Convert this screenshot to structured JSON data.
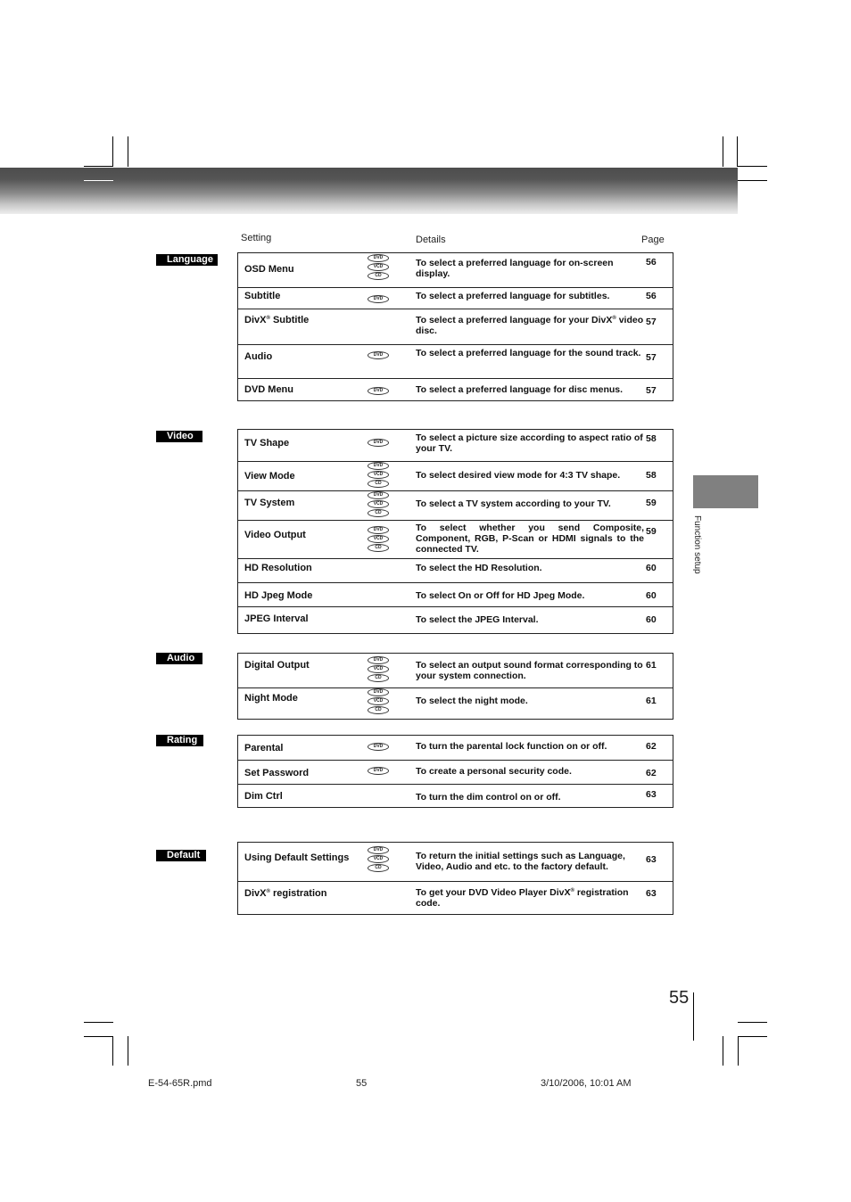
{
  "column_headers": {
    "setting": "Setting",
    "details": "Details",
    "page": "Page"
  },
  "sections": [
    {
      "label": "Language",
      "rows": [
        {
          "setting": "OSD Menu",
          "discs": [
            "DVD",
            "VCD",
            "CD"
          ],
          "details": "To select a preferred language for  on-screen display.",
          "page": "56"
        },
        {
          "setting": "Subtitle",
          "discs": [
            "DVD"
          ],
          "details": "To select a preferred language for subtitles.",
          "page": "56"
        },
        {
          "setting": "DivX® Subtitle",
          "discs": [],
          "details": "To select a preferred language for your DivX® video disc.",
          "page": "57"
        },
        {
          "setting": "Audio",
          "discs": [
            "DVD"
          ],
          "details": "To select a preferred language for the sound track.",
          "page": "57"
        },
        {
          "setting": "DVD Menu",
          "discs": [
            "DVD"
          ],
          "details": "To select a preferred language for disc menus.",
          "page": "57"
        }
      ]
    },
    {
      "label": "Video",
      "rows": [
        {
          "setting": "TV Shape",
          "discs": [
            "DVD"
          ],
          "details": "To select a picture size according to aspect ratio of your TV.",
          "page": "58"
        },
        {
          "setting": "View Mode",
          "discs": [
            "DVD",
            "VCD",
            "CD"
          ],
          "details": "To select desired view mode for 4:3 TV shape.",
          "page": "58"
        },
        {
          "setting": "TV System",
          "discs": [
            "DVD",
            "VCD",
            "CD"
          ],
          "details": "To select a TV system according to your TV.",
          "page": "59"
        },
        {
          "setting": "Video Output",
          "discs": [
            "DVD",
            "VCD",
            "CD"
          ],
          "details": "To select whether you send Composite, Component, RGB, P-Scan or HDMI signals to the connected TV.",
          "page": "59"
        },
        {
          "setting": "HD Resolution",
          "discs": [],
          "details": "To select the HD Resolution.",
          "page": "60"
        },
        {
          "setting": "HD Jpeg Mode",
          "discs": [],
          "details": "To select On or Off for HD Jpeg Mode.",
          "page": "60"
        },
        {
          "setting": "JPEG Interval",
          "discs": [],
          "details": "To select the JPEG Interval.",
          "page": "60"
        }
      ]
    },
    {
      "label": "Audio",
      "rows": [
        {
          "setting": "Digital Output",
          "discs": [
            "DVD",
            "VCD",
            "CD"
          ],
          "details": "To select an output sound format corresponding to your system connection.",
          "page": "61"
        },
        {
          "setting": "Night Mode",
          "discs": [
            "DVD",
            "VCD",
            "CD"
          ],
          "details": "To select the night mode.",
          "page": "61"
        }
      ]
    },
    {
      "label": "Rating",
      "rows": [
        {
          "setting": "Parental",
          "discs": [
            "DVD"
          ],
          "details": "To turn the parental lock function on or off.",
          "page": "62"
        },
        {
          "setting": "Set Password",
          "discs": [
            "DVD"
          ],
          "details": "To create a personal security code.",
          "page": "62"
        },
        {
          "setting": "Dim Ctrl",
          "discs": [],
          "details": "To turn the dim control on or off.",
          "page": "63"
        }
      ]
    },
    {
      "label": "Default",
      "rows": [
        {
          "setting": "Using Default Settings",
          "discs": [
            "DVD",
            "VCD",
            "CD"
          ],
          "details": "To return the initial settings such as Language, Video, Audio and etc. to the factory default.",
          "page": "63"
        },
        {
          "setting": "DivX® registration",
          "discs": [],
          "details": "To get your DVD Video Player DivX® registration code.",
          "page": "63"
        }
      ]
    }
  ],
  "side_tab": {
    "text": "Function setup"
  },
  "page_number": "55",
  "footer": {
    "file": "E-54-65R.pmd",
    "page": "55",
    "timestamp": "3/10/2006, 10:01 AM"
  }
}
